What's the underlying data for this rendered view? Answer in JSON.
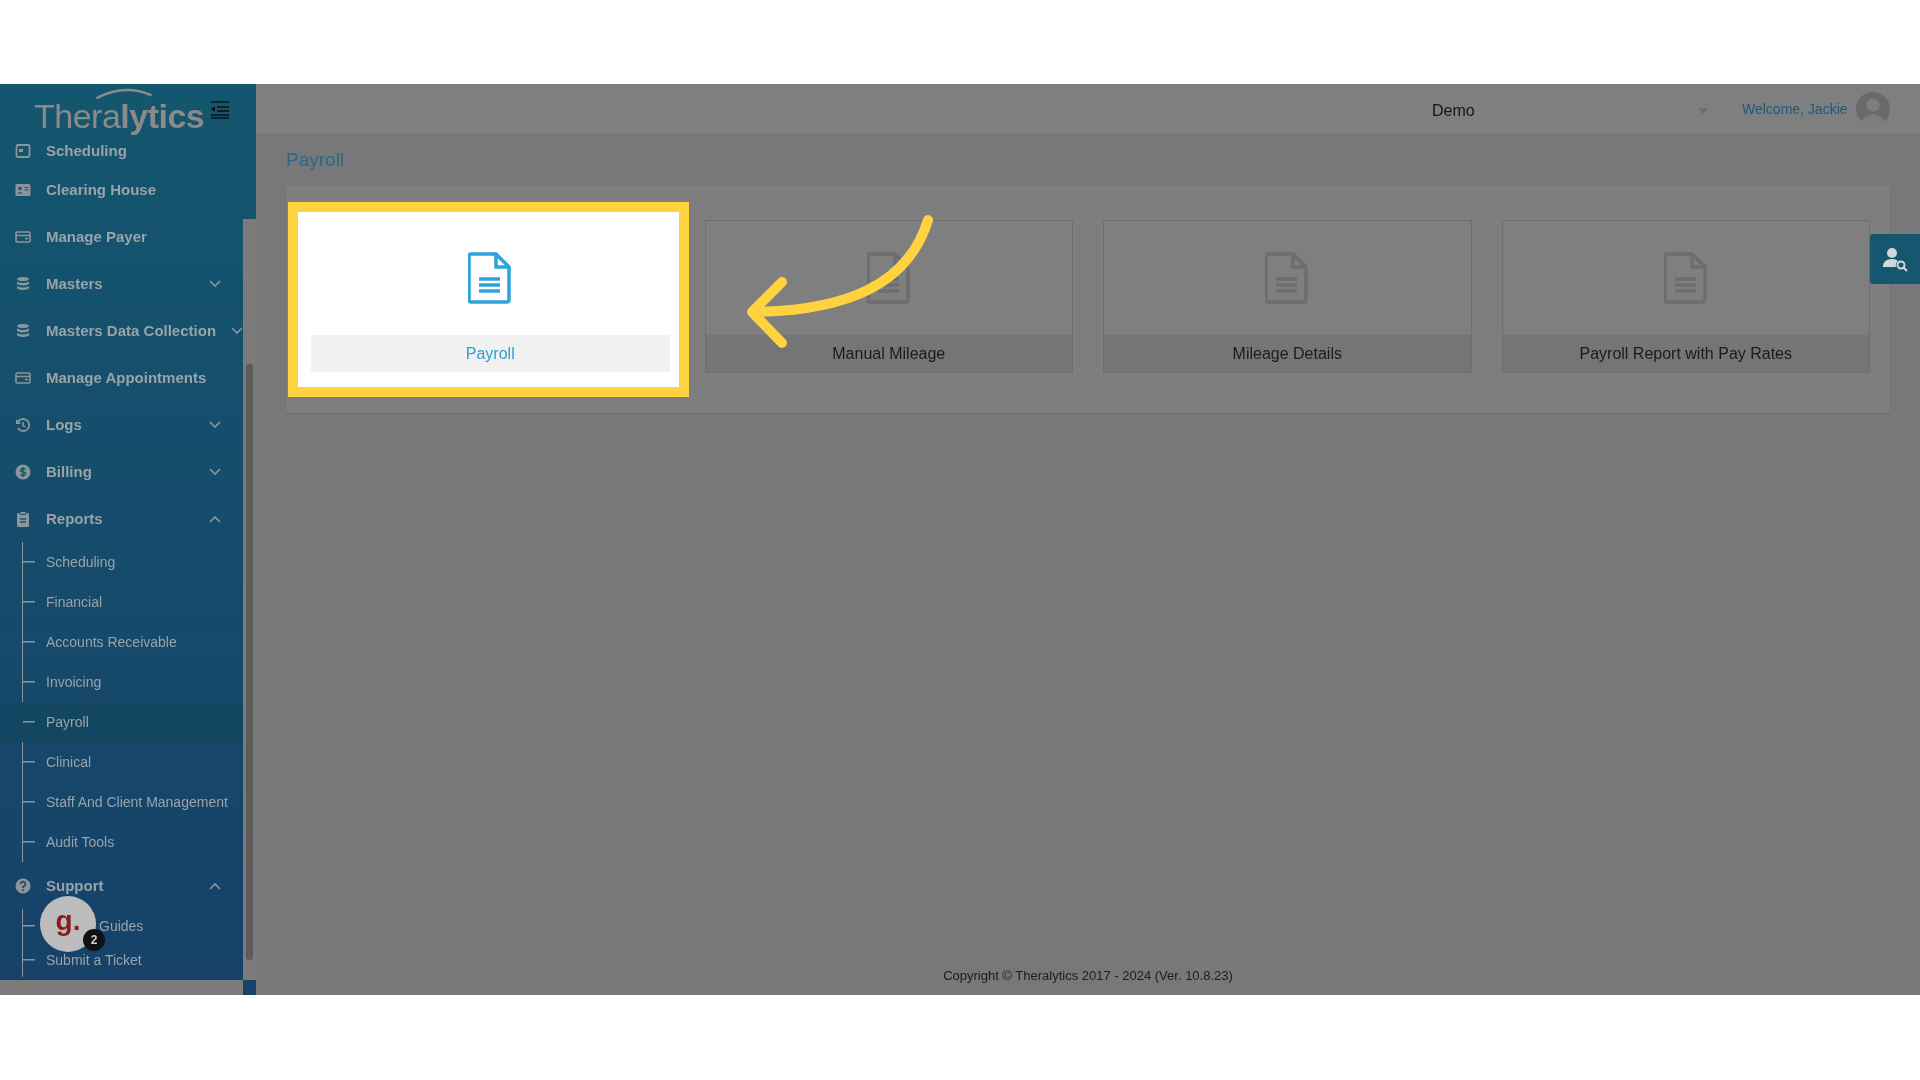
{
  "sidebar": {
    "logo": "Thera**lytics**",
    "items": [
      {
        "label": "Scheduling",
        "kind": "link"
      },
      {
        "label": "Clearing House",
        "kind": "link"
      },
      {
        "label": "Manage Payer",
        "kind": "link"
      },
      {
        "label": "Masters",
        "kind": "group",
        "expanded": false
      },
      {
        "label": "Masters Data Collection",
        "kind": "group",
        "expanded": false
      },
      {
        "label": "Manage Appointments",
        "kind": "link"
      },
      {
        "label": "Logs",
        "kind": "group",
        "expanded": false
      },
      {
        "label": "Billing",
        "kind": "group",
        "expanded": false
      },
      {
        "label": "Reports",
        "kind": "group",
        "expanded": true,
        "children": [
          {
            "label": "Scheduling",
            "selected": false
          },
          {
            "label": "Financial",
            "selected": false
          },
          {
            "label": "Accounts Receivable",
            "selected": false
          },
          {
            "label": "Invoicing",
            "selected": false
          },
          {
            "label": "Payroll",
            "selected": true
          },
          {
            "label": "Clinical",
            "selected": false
          },
          {
            "label": "Staff And Client Management",
            "selected": false
          },
          {
            "label": "Audit Tools",
            "selected": false
          }
        ]
      },
      {
        "label": "Support",
        "kind": "group",
        "expanded": true,
        "children": [
          {
            "label": "Guides",
            "selected": false
          },
          {
            "label": "Submit a Ticket",
            "selected": false
          }
        ]
      }
    ]
  },
  "header": {
    "organization": "Demo",
    "welcome": "Welcome, Jackie"
  },
  "page_title": "Payroll",
  "cards": [
    {
      "label": "Payroll",
      "highlighted": true
    },
    {
      "label": "Manual Mileage",
      "highlighted": false
    },
    {
      "label": "Mileage Details",
      "highlighted": false
    },
    {
      "label": "Payroll Report with Pay Rates",
      "highlighted": false
    }
  ],
  "chat_widget": {
    "logo": "g.",
    "badge": "2"
  },
  "footer": "Copyright © Theralytics 2017 - 2024 (Ver. 10.8.23)"
}
